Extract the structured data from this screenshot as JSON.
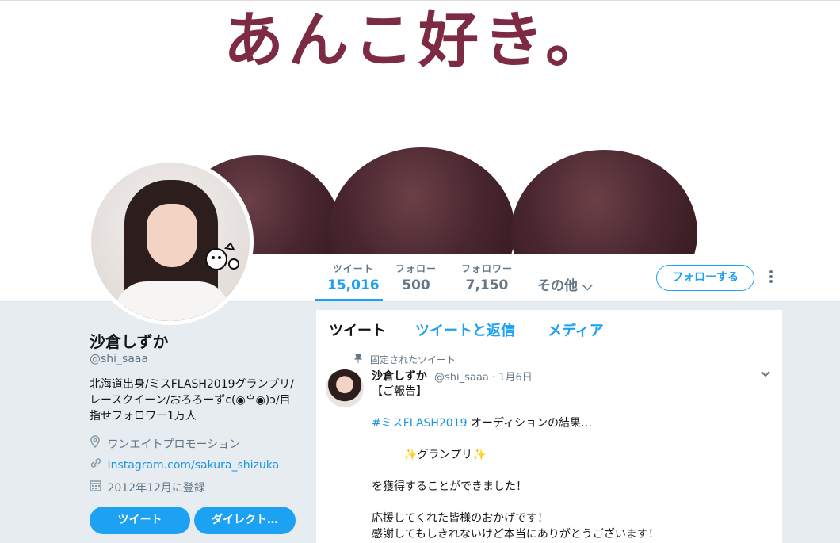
{
  "banner": {
    "text": "あんこ好き。"
  },
  "stats": [
    {
      "label": "ツイート",
      "value": "15,016"
    },
    {
      "label": "フォロー",
      "value": "500"
    },
    {
      "label": "フォロワー",
      "value": "7,150"
    }
  ],
  "nav": {
    "more_label": "その他 ⌵",
    "follow_button": "フォローする",
    "more_menu_icon": "⋮"
  },
  "profile": {
    "name": "沙倉しずか",
    "handle": "@shi_saaa",
    "bio_line1": "北海道出身/ミスFLASH2019グランプリ/",
    "bio_line2": "レースクイーン/おろろーずc(◉ᅌ◉)ɔ/目",
    "bio_line3": "指せフォロワー1万人",
    "location": "ワンエイトプロモーション",
    "link": "Instagram.com/sakura_shizuka",
    "joined": "2012年12月に登録",
    "tweet_button": "ツイート",
    "dm_button": "ダイレクト…",
    "icons": {
      "location": "location-pin-icon",
      "link": "link-icon",
      "calendar": "calendar-icon"
    }
  },
  "timeline": {
    "tabs": [
      "ツイート",
      "ツイートと返信",
      "メディア"
    ],
    "pinned_label": "固定されたツイート",
    "tweet": {
      "author": "沙倉しずか",
      "handle_date": "@shi_saaa · 1月6日",
      "line1": "【ご報告】",
      "hashtag": "#ミスFLASH2019",
      "line2_rest": " オーディションの結果…",
      "line3": "✨グランプリ✨",
      "line4": "を獲得することができました！",
      "line5": "応援してくれた皆様のおかげです！",
      "line6": "感謝してもしきれないけど本当にありがとうございます！"
    }
  },
  "colors": {
    "accent": "#1da1f2",
    "link": "#1b95e0",
    "banner_text": "#7d2a43"
  }
}
